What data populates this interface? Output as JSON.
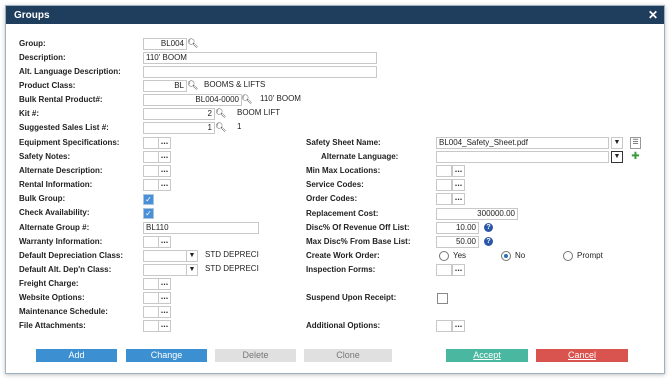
{
  "window": {
    "title": "Groups",
    "close": "✕"
  },
  "left": {
    "group": {
      "label": "Group:",
      "value": "BL004"
    },
    "description": {
      "label": "Description:",
      "value": "110' BOOM"
    },
    "alt_language_description": {
      "label": "Alt. Language Description:",
      "value": ""
    },
    "product_class": {
      "label": "Product Class:",
      "value": "BL",
      "text": "BOOMS & LIFTS"
    },
    "bulk_rental_product": {
      "label": "Bulk Rental Product#:",
      "value": "BL004-0000",
      "text": "110' BOOM"
    },
    "kit": {
      "label": "Kit #:",
      "value": "2",
      "text": "BOOM LIFT"
    },
    "suggested_sales_list": {
      "label": "Suggested Sales List #:",
      "value": "1",
      "text": "1"
    },
    "equipment_specifications": {
      "label": "Equipment Specifications:"
    },
    "safety_notes": {
      "label": "Safety Notes:"
    },
    "alternate_description": {
      "label": "Alternate Description:"
    },
    "rental_information": {
      "label": "Rental Information:"
    },
    "bulk_group": {
      "label": "Bulk Group:",
      "checked": true
    },
    "check_availability": {
      "label": "Check Availability:",
      "checked": true
    },
    "alternate_group": {
      "label": "Alternate Group #:",
      "value": "BL110"
    },
    "warranty_information": {
      "label": "Warranty Information:"
    },
    "default_depreciation_class": {
      "label": "Default Depreciation Class:",
      "text": "STD DEPRECI"
    },
    "default_alt_depn_class": {
      "label": "Default Alt. Dep'n Class:",
      "text": "STD DEPRECI"
    },
    "freight_charge": {
      "label": "Freight Charge:"
    },
    "website_options": {
      "label": "Website Options:"
    },
    "maintenance_schedule": {
      "label": "Maintenance Schedule:"
    },
    "file_attachments": {
      "label": "File Attachments:"
    }
  },
  "right": {
    "safety_sheet_name": {
      "label": "Safety Sheet Name:",
      "value": "BL004_Safety_Sheet.pdf"
    },
    "alternate_language": {
      "label": "Alternate Language:",
      "value": ""
    },
    "min_max_locations": {
      "label": "Min Max Locations:"
    },
    "service_codes": {
      "label": "Service Codes:"
    },
    "order_codes": {
      "label": "Order Codes:"
    },
    "replacement_cost": {
      "label": "Replacement Cost:",
      "value": "300000.00"
    },
    "disc_off_revenue": {
      "label": "Disc% Of Revenue Off List:",
      "value": "10.00"
    },
    "max_disc_from_base": {
      "label": "Max Disc% From Base List:",
      "value": "50.00"
    },
    "create_work_order": {
      "label": "Create Work Order:",
      "options": [
        "Yes",
        "No",
        "Prompt"
      ],
      "selected": "No"
    },
    "inspection_forms": {
      "label": "Inspection Forms:"
    },
    "suspend_upon_receipt": {
      "label": "Suspend Upon Receipt:",
      "checked": false
    },
    "additional_options": {
      "label": "Additional Options:"
    }
  },
  "buttons": {
    "add": "Add",
    "change": "Change",
    "delete": "Delete",
    "clone": "Clone",
    "accept": "Accept",
    "cancel": "Cancel"
  },
  "colors": {
    "titlebar": "#1f3d5c",
    "blue_button": "#3c8fd1",
    "accept": "#4ab8a0",
    "cancel": "#d9534f"
  }
}
